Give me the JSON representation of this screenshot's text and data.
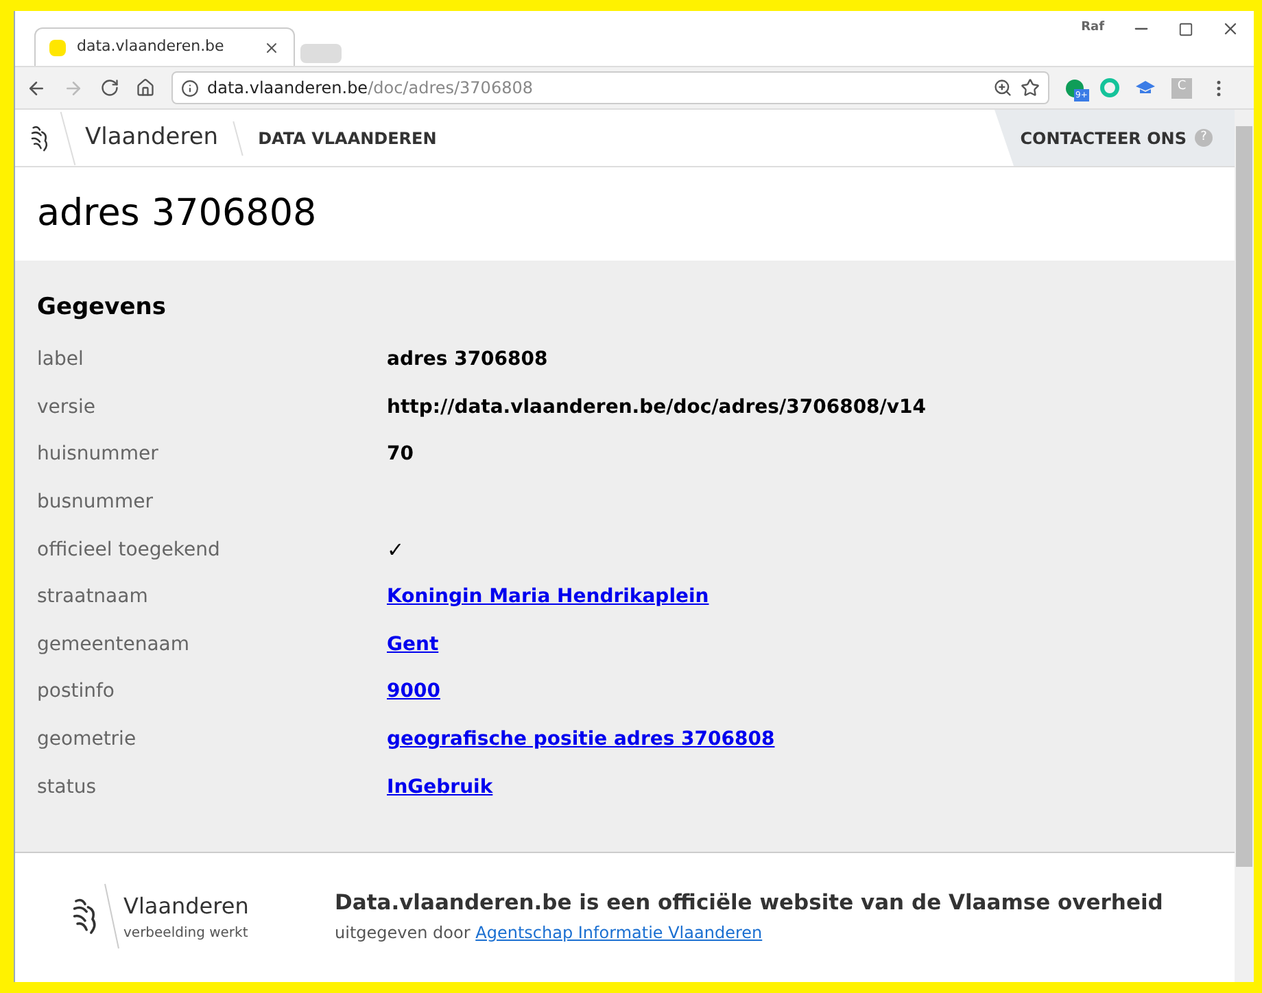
{
  "browser": {
    "tab_title": "data.vlaanderen.be",
    "profile": "Raf",
    "url_host": "data.vlaanderen.be",
    "url_path": "/doc/adres/3706808",
    "extension_badge": "9+",
    "extension_letter": "C"
  },
  "header": {
    "brand": "Vlaanderen",
    "site": "DATA VLAANDEREN",
    "contact": "CONTACTEER ONS",
    "help": "?"
  },
  "title": "adres 3706808",
  "section": {
    "heading": "Gegevens",
    "rows": [
      {
        "label": "label",
        "kind": "text",
        "value": "adres 3706808"
      },
      {
        "label": "versie",
        "kind": "text",
        "value": "http://data.vlaanderen.be/doc/adres/3706808/v14"
      },
      {
        "label": "huisnummer",
        "kind": "text",
        "value": "70"
      },
      {
        "label": "busnummer",
        "kind": "empty"
      },
      {
        "label": "officieel toegekend",
        "kind": "check",
        "value": "✓"
      },
      {
        "label": "straatnaam",
        "kind": "link",
        "value": "Koningin Maria Hendrikaplein"
      },
      {
        "label": "gemeentenaam",
        "kind": "link",
        "value": "Gent"
      },
      {
        "label": "postinfo",
        "kind": "link",
        "value": "9000"
      },
      {
        "label": "geometrie",
        "kind": "link",
        "value": "geografische positie adres 3706808"
      },
      {
        "label": "status",
        "kind": "link",
        "value": "InGebruik"
      }
    ]
  },
  "footer": {
    "brand": "Vlaanderen",
    "tagline": "verbeelding werkt",
    "statement": "Data.vlaanderen.be is een officiële website van de Vlaamse overheid",
    "published_by": "uitgegeven door",
    "publisher_link": "Agentschap Informatie Vlaanderen"
  }
}
